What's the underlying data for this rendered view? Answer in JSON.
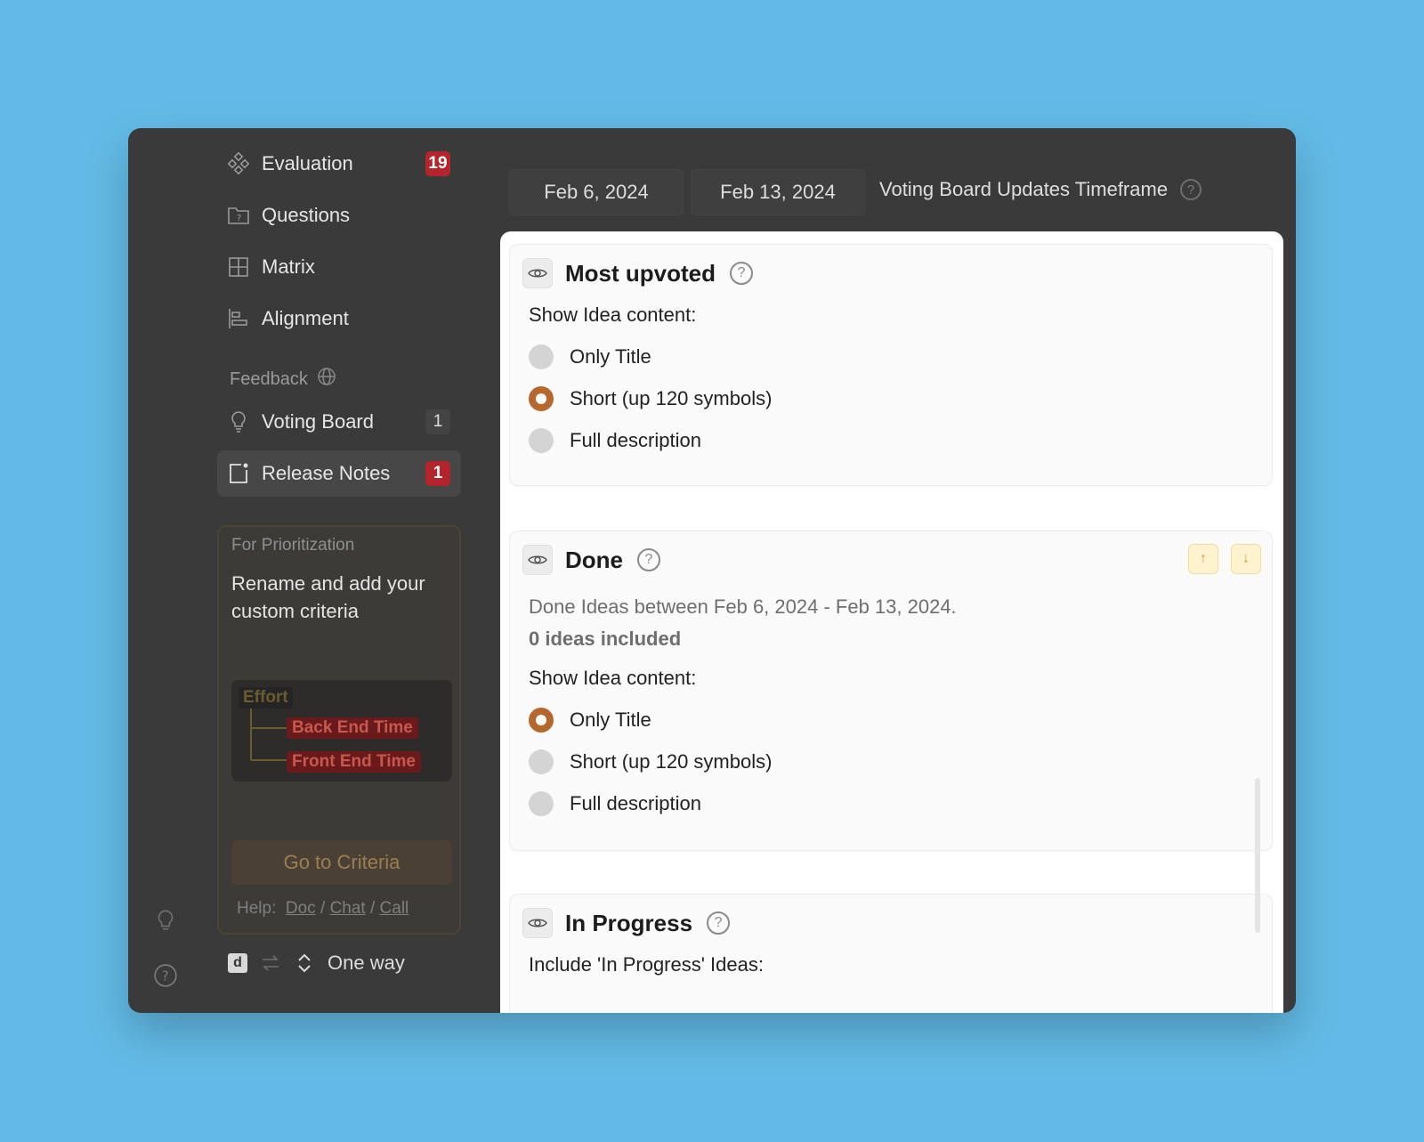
{
  "sidebar": {
    "items": [
      {
        "label": "Evaluation",
        "icon": "evaluation-icon",
        "badge": "19",
        "badge_style": "red"
      },
      {
        "label": "Questions",
        "icon": "questions-icon"
      },
      {
        "label": "Matrix",
        "icon": "matrix-icon"
      },
      {
        "label": "Alignment",
        "icon": "alignment-icon"
      }
    ],
    "section_label": "Feedback",
    "feedback_items": [
      {
        "label": "Voting Board",
        "icon": "lightbulb-icon",
        "badge": "1",
        "badge_style": "gray"
      },
      {
        "label": "Release Notes",
        "icon": "release-notes-icon",
        "badge": "1",
        "badge_style": "red"
      }
    ],
    "promo": {
      "label": "For Prioritization",
      "text": "Rename and add your custom criteria",
      "image_chips": {
        "effort": "Effort",
        "back_end": "Back End Time",
        "front_end": "Front End Time"
      },
      "button": "Go to Criteria",
      "help_label": "Help:",
      "help_links": [
        "Doc",
        "Chat",
        "Call"
      ],
      "help_separator": "/"
    },
    "bottom": {
      "sync_label": "One way",
      "d_label": "d"
    }
  },
  "header": {
    "start_date": "Feb 6, 2024",
    "end_date": "Feb 13, 2024",
    "timeframe_label": "Voting Board Updates Timeframe"
  },
  "cards": {
    "most_upvoted": {
      "title": "Most upvoted",
      "show_label": "Show Idea content:",
      "options": [
        "Only Title",
        "Short (up 120 symbols)",
        "Full description"
      ],
      "selected": 1
    },
    "done": {
      "title": "Done",
      "description": "Done Ideas between Feb 6, 2024 - Feb 13, 2024.",
      "count": "0 ideas included",
      "show_label": "Show Idea content:",
      "options": [
        "Only Title",
        "Short (up 120 symbols)",
        "Full description"
      ],
      "selected": 0,
      "up_arrow": "↑",
      "down_arrow": "↓"
    },
    "in_progress": {
      "title": "In Progress",
      "include_label": "Include 'In Progress' Ideas:"
    }
  },
  "colors": {
    "accent": "#b5682e",
    "badge_red": "#b3252a",
    "background": "#62bbe6"
  }
}
